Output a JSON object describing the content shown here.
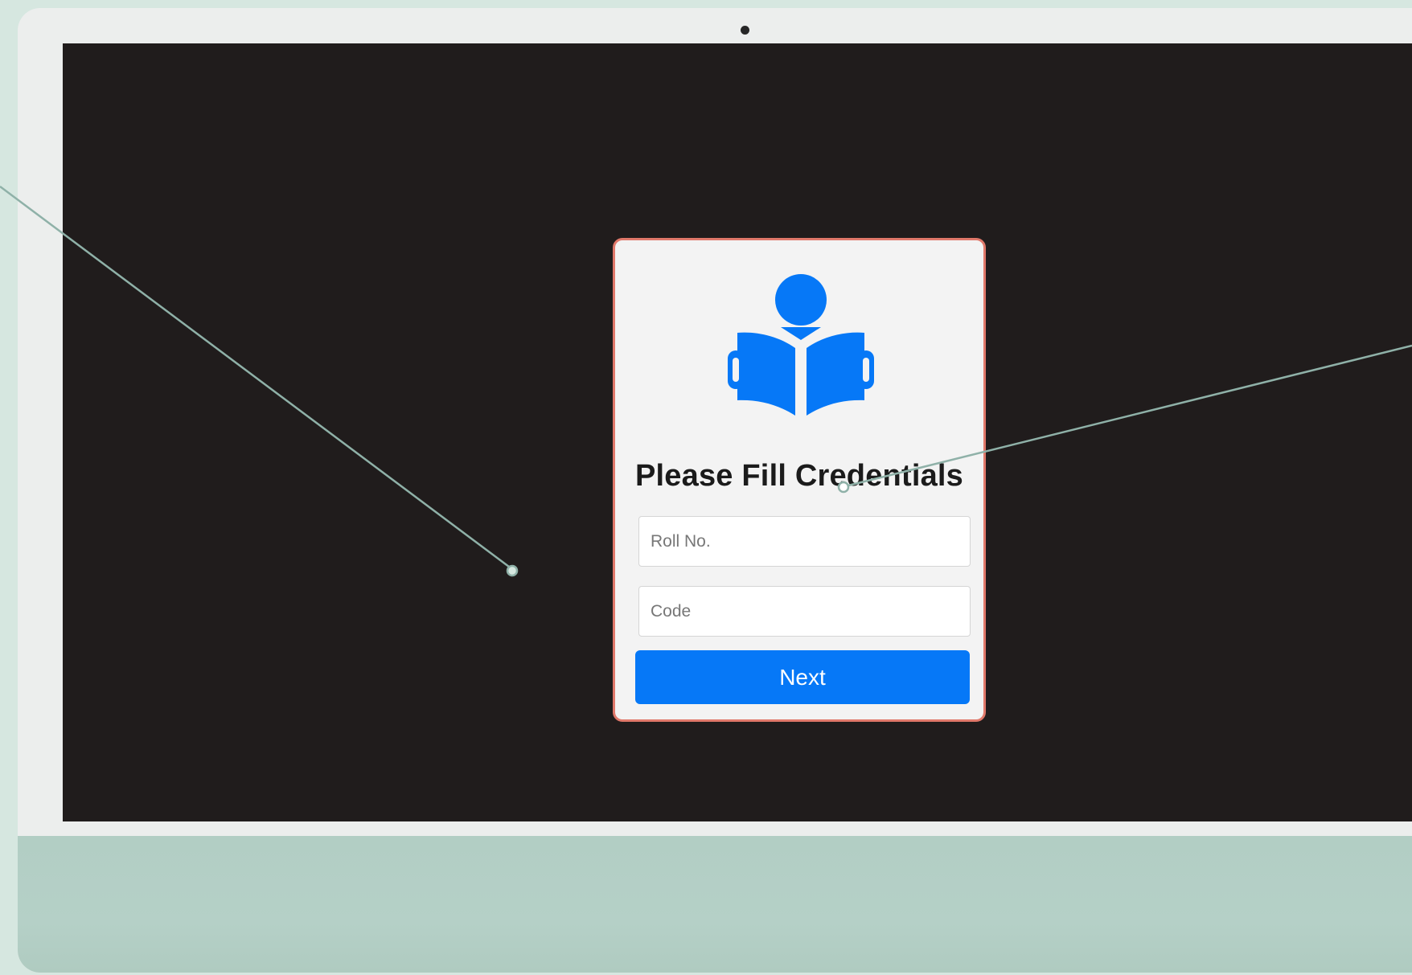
{
  "login_card": {
    "logo_icon": "reading-book-icon",
    "title": "Please Fill Credentials",
    "roll_placeholder": "Roll No.",
    "code_placeholder": "Code",
    "next_label": "Next"
  },
  "colors": {
    "accent": "#0678f7",
    "card_border": "#e0786a",
    "screen_bg": "#201c1c",
    "device_bg": "#d6e7e0",
    "callout_line": "#8fb1a8"
  }
}
